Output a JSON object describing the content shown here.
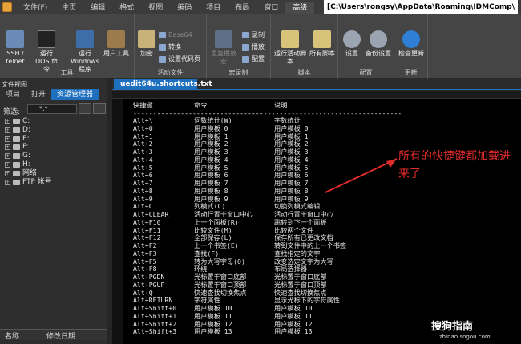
{
  "titlebar": {
    "tabs": [
      "文件(F)",
      "主页",
      "编辑",
      "格式",
      "视图",
      "编码",
      "项目",
      "布局",
      "窗口",
      "高级"
    ],
    "active_tab": 9,
    "path": "[C:\\Users\\rongsy\\AppData\\Roaming\\IDMComp\\"
  },
  "ribbon": {
    "groups": [
      {
        "label": "工具",
        "buttons": [
          "SSH / telnet",
          "运行 DOS 命令",
          "运行 Windows 程序",
          "用户工具"
        ]
      },
      {
        "label": "活动文件",
        "buttons": [
          "加密",
          "Base64",
          "转换",
          "设置代码页"
        ]
      },
      {
        "label": "宏录制",
        "buttons": [
          "录制",
          "播放",
          "配置",
          "重复播放宏"
        ]
      },
      {
        "label": "脚本",
        "buttons": [
          "运行活动脚本",
          "所有脚本"
        ]
      },
      {
        "label": "配置",
        "buttons": [
          "设置",
          "备份设置"
        ]
      },
      {
        "label": "更新",
        "buttons": [
          "检查更新"
        ]
      }
    ]
  },
  "leftpanel": {
    "title": "文件视图",
    "tabs": [
      "项目",
      "打开",
      "资源管理器"
    ],
    "filter_label": "筛选:",
    "filter_value": "*.*",
    "drives": [
      "C:",
      "D:",
      "E:",
      "F:",
      "G:",
      "H:",
      "网络",
      "FTP 帐号"
    ],
    "footer": [
      "名称",
      "修改日期"
    ]
  },
  "editor": {
    "tab_label": "uedit64u.shortcuts.txt",
    "header": [
      "快捷键",
      "命令",
      "说明"
    ],
    "separator": "--------------------------------------------------------------------",
    "rows": [
      [
        "Alt+\\",
        "词数统计(W)",
        "字数统计"
      ],
      [
        "Alt+0",
        "用户模板 0",
        "用户模板 0"
      ],
      [
        "Alt+1",
        "用户模板 1",
        "用户模板 1"
      ],
      [
        "Alt+2",
        "用户模板 2",
        "用户模板 2"
      ],
      [
        "Alt+3",
        "用户模板 3",
        "用户模板 3"
      ],
      [
        "Alt+4",
        "用户模板 4",
        "用户模板 4"
      ],
      [
        "Alt+5",
        "用户模板 5",
        "用户模板 5"
      ],
      [
        "Alt+6",
        "用户模板 6",
        "用户模板 6"
      ],
      [
        "Alt+7",
        "用户模板 7",
        "用户模板 7"
      ],
      [
        "Alt+8",
        "用户模板 8",
        "用户模板 8"
      ],
      [
        "Alt+9",
        "用户模板 9",
        "用户模板 9"
      ],
      [
        "Alt+C",
        "列模式(C)",
        "切换列模式编辑"
      ],
      [
        "Alt+CLEAR",
        "活动行置于窗口中心",
        "活动行置于窗口中心"
      ],
      [
        "Alt+F10",
        "上一个面板(R)",
        "跳转到下一个面板"
      ],
      [
        "Alt+F11",
        "比较文件(M)",
        "比较两个文件"
      ],
      [
        "Alt+F12",
        "全部保存(L)",
        "保存所有已更改文档"
      ],
      [
        "Alt+F2",
        "上一个书签(E)",
        "转到文件中的上一个书签"
      ],
      [
        "Alt+F3",
        "查找(F)",
        "查找指定的文字"
      ],
      [
        "Alt+F5",
        "转为大写字母(O)",
        "改变选定文字为大写"
      ],
      [
        "Alt+F8",
        "环绕",
        "布局选择器"
      ],
      [
        "Alt+PGDN",
        "光标置于窗口底部",
        "光标置于窗口底部"
      ],
      [
        "Alt+PGUP",
        "光标置于窗口顶部",
        "光标置于窗口顶部"
      ],
      [
        "Alt+Q",
        "快速查找切换焦点",
        "快速查找切换焦点"
      ],
      [
        "Alt+RETURN",
        "字符属性",
        "显示光标下的字符属性"
      ],
      [
        "Alt+Shift+0",
        "用户模板 10",
        "用户模板 10"
      ],
      [
        "Alt+Shift+1",
        "用户模板 11",
        "用户模板 11"
      ],
      [
        "Alt+Shift+2",
        "用户模板 12",
        "用户模板 12"
      ],
      [
        "Alt+Shift+3",
        "用户模板 13",
        "用户模板 13"
      ]
    ]
  },
  "annotation": "所有的快捷键都加载进来了",
  "watermark": {
    "text": "搜狗指南",
    "sub": "zhinan.sogou.com"
  },
  "colors": {
    "accent": "#1f6fbf",
    "annotation": "#e02b2b"
  }
}
